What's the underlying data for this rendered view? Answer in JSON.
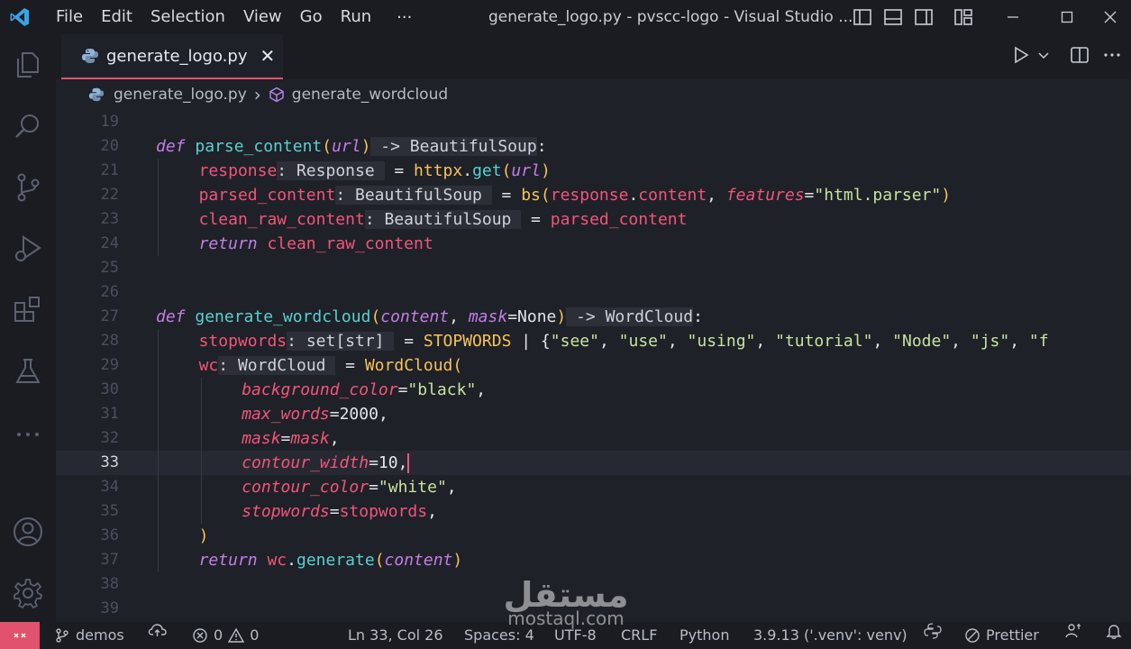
{
  "titlebar": {
    "menu": [
      "File",
      "Edit",
      "Selection",
      "View",
      "Go",
      "Run"
    ],
    "more": "···",
    "window_title": "generate_logo.py - pvscc-logo - Visual Studio ..."
  },
  "activitybar": {
    "icons": [
      "explorer-icon",
      "search-icon",
      "source-control-icon",
      "run-debug-icon",
      "extensions-icon",
      "testing-icon",
      "more-icon",
      "account-icon",
      "settings-gear-icon"
    ]
  },
  "tab": {
    "label": "generate_logo.py",
    "close": "✕"
  },
  "breadcrumb": {
    "file": "generate_logo.py",
    "separator": "›",
    "symbol": "generate_wordcloud"
  },
  "code": {
    "line_numbers": [
      "19",
      "20",
      "21",
      "22",
      "23",
      "24",
      "25",
      "26",
      "27",
      "28",
      "29",
      "30",
      "31",
      "32",
      "33",
      "34",
      "35",
      "36",
      "37",
      "38",
      "39"
    ],
    "current_line": "33",
    "l20": {
      "def": "def",
      "name": "parse_content",
      "open": "(",
      "param": "url",
      "close": ")",
      "arrow": " -> BeautifulSoup",
      "colon": ":"
    },
    "l21": {
      "var": "response",
      "hint": ": Response ",
      "eq": " = ",
      "call": "httpx",
      "dot": ".",
      "method": "get",
      "open": "(",
      "arg": "url",
      "close": ")"
    },
    "l22": {
      "var": "parsed_content",
      "hint": ": BeautifulSoup ",
      "eq": " = ",
      "call": "bs",
      "open": "(",
      "a1": "response",
      "dot": ".",
      "a2": "content",
      "comma": ", ",
      "kw": "features",
      "assign": "=",
      "str": "\"html.parser\"",
      "close": ")"
    },
    "l23": {
      "var": "clean_raw_content",
      "hint": ": BeautifulSoup ",
      "eq": " = ",
      "val": "parsed_content"
    },
    "l24": {
      "ret": "return",
      "val": " clean_raw_content"
    },
    "l27": {
      "def": "def",
      "name": "generate_wordcloud",
      "open": "(",
      "p1": "content",
      "comma": ", ",
      "p2": "mask",
      "default": "=None",
      "close": ")",
      "arrow": " -> WordCloud",
      "colon": ":"
    },
    "l28": {
      "var": "stopwords",
      "hint": ": set[str] ",
      "eq": " = ",
      "const": "STOPWORDS",
      "op": " | {",
      "s1": "\"see\"",
      "s2": "\"use\"",
      "s3": "\"using\"",
      "s4": "\"tutorial\"",
      "s5": "\"Node\"",
      "s6": "\"js\"",
      "s7": "\"f",
      "sep": ", "
    },
    "l29": {
      "var": "wc",
      "hint": ": WordCloud ",
      "eq": " = ",
      "call": "WordCloud",
      "open": "("
    },
    "l30": {
      "kw": "background_color",
      "assign": "=",
      "str": "\"black\"",
      "comma": ","
    },
    "l31": {
      "kw": "max_words",
      "assign": "=",
      "val": "2000",
      "comma": ","
    },
    "l32": {
      "kw": "mask",
      "assign": "=",
      "val": "mask",
      "comma": ","
    },
    "l33": {
      "kw": "contour_width",
      "assign": "=",
      "val": "10",
      "comma": ","
    },
    "l34": {
      "kw": "contour_color",
      "assign": "=",
      "str": "\"white\"",
      "comma": ","
    },
    "l35": {
      "kw": "stopwords",
      "assign": "=",
      "val": "stopwords",
      "comma": ","
    },
    "l36": {
      "close": ")"
    },
    "l37": {
      "ret": "return",
      "call": " wc",
      "dot": ".",
      "method": "generate",
      "open": "(",
      "arg": "content",
      "close": ")"
    }
  },
  "statusbar": {
    "branch": "demos",
    "errors": "0",
    "warnings": "0",
    "position": "Ln 33, Col 26",
    "spaces": "Spaces: 4",
    "encoding": "UTF-8",
    "eol": "CRLF",
    "language": "Python",
    "interpreter": "3.9.13 ('.venv': venv)",
    "formatter": "Prettier"
  },
  "watermark": {
    "arabic": "مستقل",
    "latin": "mostaql.com"
  },
  "colors": {
    "accent": "#e0526d",
    "keyword": "#c27ee6",
    "function": "#5ad0d0",
    "variable": "#f2557a",
    "string": "#c6e3a0",
    "bracket": "#f5c35b"
  }
}
